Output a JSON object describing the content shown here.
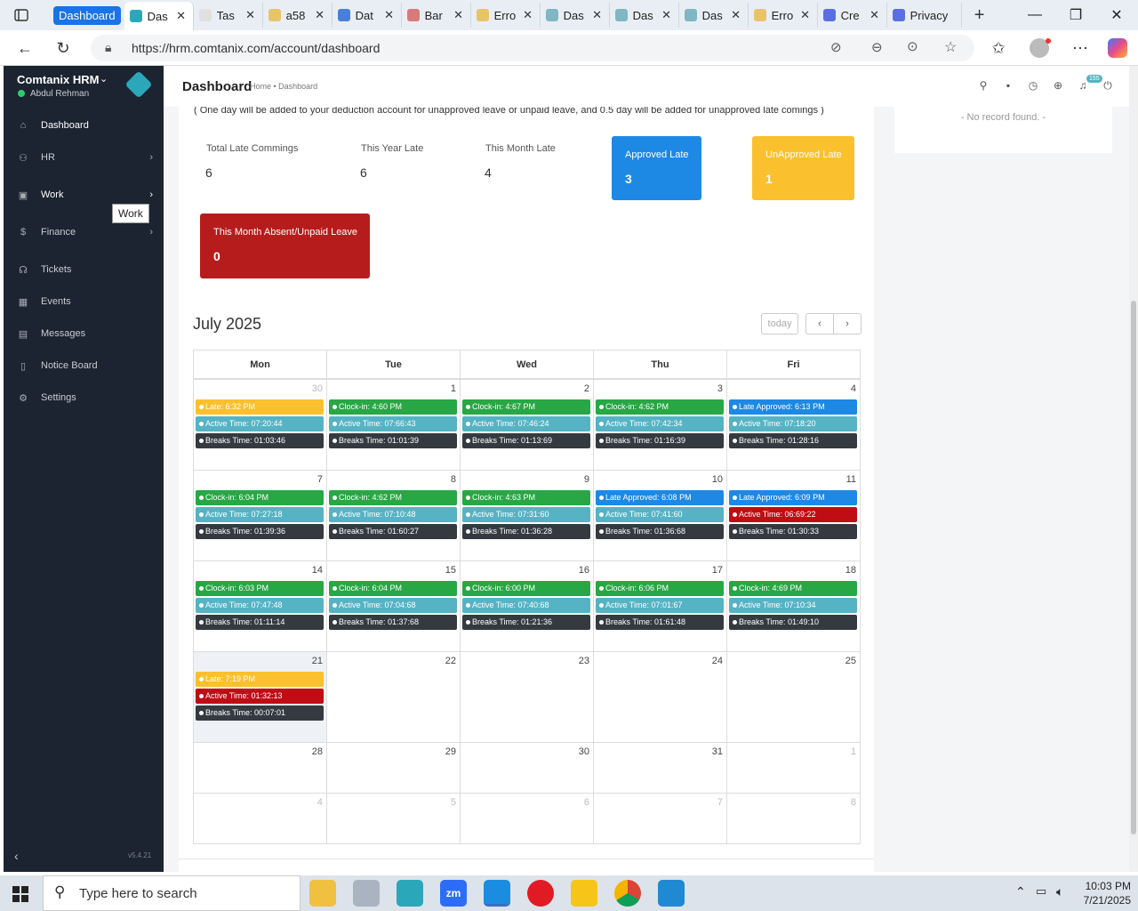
{
  "browser": {
    "tabs": [
      {
        "title": "Dashboard",
        "group": true
      },
      {
        "title": "Das",
        "active": true,
        "color": "#2aa7b8"
      },
      {
        "title": "Tas",
        "color": "#e0e0e0"
      },
      {
        "title": "a58",
        "color": "#e8c36a"
      },
      {
        "title": "Dat",
        "color": "#4a7fd8"
      },
      {
        "title": "Bar",
        "color": "#d97a7a"
      },
      {
        "title": "Erro",
        "color": "#e8c36a"
      },
      {
        "title": "Das",
        "color": "#7fb7c4"
      },
      {
        "title": "Das",
        "color": "#7fb7c4"
      },
      {
        "title": "Das",
        "color": "#7fb7c4"
      },
      {
        "title": "Erro",
        "color": "#e8c36a"
      },
      {
        "title": "Cre",
        "color": "#5b6ee1"
      },
      {
        "title": "Privacy",
        "color": "#5b6ee1"
      }
    ],
    "url": "https://hrm.comtanix.com/account/dashboard"
  },
  "sidebar": {
    "brand": "Comtanix HRM",
    "user": "Abdul Rehman",
    "items": [
      {
        "label": "Dashboard",
        "icon": "home-icon",
        "glyph": "⌂"
      },
      {
        "label": "HR",
        "icon": "users-icon",
        "glyph": "⚇"
      },
      {
        "label": "Work",
        "icon": "briefcase-icon",
        "glyph": "▣"
      },
      {
        "label": "Finance",
        "icon": "dollar-icon",
        "glyph": "$"
      },
      {
        "label": "Tickets",
        "icon": "ticket-icon",
        "glyph": "☊"
      },
      {
        "label": "Events",
        "icon": "calendar-icon",
        "glyph": "▦"
      },
      {
        "label": "Messages",
        "icon": "message-icon",
        "glyph": "▤"
      },
      {
        "label": "Notice Board",
        "icon": "clipboard-icon",
        "glyph": "▯"
      },
      {
        "label": "Settings",
        "icon": "gear-icon",
        "glyph": "⚙"
      }
    ],
    "tooltip": "Work",
    "version": "v5.4.21"
  },
  "header": {
    "title": "Dashboard",
    "breadcrumb": "Home • Dashboard",
    "notif_count": "155"
  },
  "note": "( One day will be added to your deduction account for unapproved leave or unpaid leave, and 0.5 day will be added for unapproved late comings )",
  "side_panel": {
    "empty": "- No record found. -"
  },
  "stats": [
    {
      "label": "Total Late Commings",
      "value": "6"
    },
    {
      "label": "This Year Late",
      "value": "6"
    },
    {
      "label": "This Month Late",
      "value": "4"
    }
  ],
  "boxes": [
    {
      "label": "Approved Late",
      "value": "3",
      "color": "#1e88e5"
    },
    {
      "label": "UnApproved Late",
      "value": "1",
      "color": "#fbc02d"
    },
    {
      "label": "This Month Absent/Unpaid Leave",
      "value": "0",
      "color": "#b71c1c"
    }
  ],
  "calendar": {
    "month": "July 2025",
    "today_btn": "today",
    "days": [
      "Mon",
      "Tue",
      "Wed",
      "Thu",
      "Fri"
    ],
    "colors": {
      "late": "#fbc02d",
      "clockin": "#28a745",
      "approved": "#1e88e5",
      "active": "#56b3c4",
      "danger": "#c00c14",
      "breaks": "#343a40"
    },
    "weeks": [
      [
        {
          "d": "30",
          "o": true,
          "ev": [
            [
              "late",
              "Late: 6:32 PM"
            ],
            [
              "active",
              "Active Time: 07:20:44"
            ],
            [
              "breaks",
              "Breaks Time: 01:03:46"
            ]
          ]
        },
        {
          "d": "1",
          "ev": [
            [
              "clockin",
              "Clock-in: 4:60 PM"
            ],
            [
              "active",
              "Active Time: 07:66:43"
            ],
            [
              "breaks",
              "Breaks Time: 01:01:39"
            ]
          ]
        },
        {
          "d": "2",
          "ev": [
            [
              "clockin",
              "Clock-in: 4:67 PM"
            ],
            [
              "active",
              "Active Time: 07:46:24"
            ],
            [
              "breaks",
              "Breaks Time: 01:13:69"
            ]
          ]
        },
        {
          "d": "3",
          "ev": [
            [
              "clockin",
              "Clock-in: 4:62 PM"
            ],
            [
              "active",
              "Active Time: 07:42:34"
            ],
            [
              "breaks",
              "Breaks Time: 01:16:39"
            ]
          ]
        },
        {
          "d": "4",
          "ev": [
            [
              "approved",
              "Late Approved: 6:13 PM"
            ],
            [
              "active",
              "Active Time: 07:18:20"
            ],
            [
              "breaks",
              "Breaks Time: 01:28:16"
            ]
          ]
        }
      ],
      [
        {
          "d": "7",
          "ev": [
            [
              "clockin",
              "Clock-in: 6:04 PM"
            ],
            [
              "active",
              "Active Time: 07:27:18"
            ],
            [
              "breaks",
              "Breaks Time: 01:39:36"
            ]
          ]
        },
        {
          "d": "8",
          "ev": [
            [
              "clockin",
              "Clock-in: 4:62 PM"
            ],
            [
              "active",
              "Active Time: 07:10:48"
            ],
            [
              "breaks",
              "Breaks Time: 01:60:27"
            ]
          ]
        },
        {
          "d": "9",
          "ev": [
            [
              "clockin",
              "Clock-in: 4:63 PM"
            ],
            [
              "active",
              "Active Time: 07:31:60"
            ],
            [
              "breaks",
              "Breaks Time: 01:36:28"
            ]
          ]
        },
        {
          "d": "10",
          "ev": [
            [
              "approved",
              "Late Approved: 6:08 PM"
            ],
            [
              "active",
              "Active Time: 07:41:60"
            ],
            [
              "breaks",
              "Breaks Time: 01:36:68"
            ]
          ]
        },
        {
          "d": "11",
          "ev": [
            [
              "approved",
              "Late Approved: 6:09 PM"
            ],
            [
              "danger",
              "Active Time: 06:69:22"
            ],
            [
              "breaks",
              "Breaks Time: 01:30:33"
            ]
          ]
        }
      ],
      [
        {
          "d": "14",
          "ev": [
            [
              "clockin",
              "Clock-in: 6:03 PM"
            ],
            [
              "active",
              "Active Time: 07:47:48"
            ],
            [
              "breaks",
              "Breaks Time: 01:11:14"
            ]
          ]
        },
        {
          "d": "15",
          "ev": [
            [
              "clockin",
              "Clock-in: 6:04 PM"
            ],
            [
              "active",
              "Active Time: 07:04:68"
            ],
            [
              "breaks",
              "Breaks Time: 01:37:68"
            ]
          ]
        },
        {
          "d": "16",
          "ev": [
            [
              "clockin",
              "Clock-in: 6:00 PM"
            ],
            [
              "active",
              "Active Time: 07:40:68"
            ],
            [
              "breaks",
              "Breaks Time: 01:21:36"
            ]
          ]
        },
        {
          "d": "17",
          "ev": [
            [
              "clockin",
              "Clock-in: 6:06 PM"
            ],
            [
              "active",
              "Active Time: 07:01:67"
            ],
            [
              "breaks",
              "Breaks Time: 01:61:48"
            ]
          ]
        },
        {
          "d": "18",
          "ev": [
            [
              "clockin",
              "Clock-in: 4:69 PM"
            ],
            [
              "active",
              "Active Time: 07:10:34"
            ],
            [
              "breaks",
              "Breaks Time: 01:49:10"
            ]
          ]
        }
      ],
      [
        {
          "d": "21",
          "today": true,
          "ev": [
            [
              "late",
              "Late: 7:19 PM"
            ],
            [
              "danger",
              "Active Time: 01:32:13"
            ],
            [
              "breaks",
              "Breaks Time: 00:07:01"
            ]
          ]
        },
        {
          "d": "22",
          "ev": []
        },
        {
          "d": "23",
          "ev": []
        },
        {
          "d": "24",
          "ev": []
        },
        {
          "d": "25",
          "ev": []
        }
      ],
      [
        {
          "d": "28",
          "ev": []
        },
        {
          "d": "29",
          "ev": []
        },
        {
          "d": "30",
          "ev": []
        },
        {
          "d": "31",
          "ev": []
        },
        {
          "d": "1",
          "o": true,
          "ev": []
        }
      ],
      [
        {
          "d": "4",
          "o": true,
          "ev": []
        },
        {
          "d": "5",
          "o": true,
          "ev": []
        },
        {
          "d": "6",
          "o": true,
          "ev": []
        },
        {
          "d": "7",
          "o": true,
          "ev": []
        },
        {
          "d": "8",
          "o": true,
          "ev": []
        }
      ]
    ]
  },
  "taskbar": {
    "search": "Type here to search",
    "time": "10:03 PM",
    "date": "7/21/2025"
  }
}
